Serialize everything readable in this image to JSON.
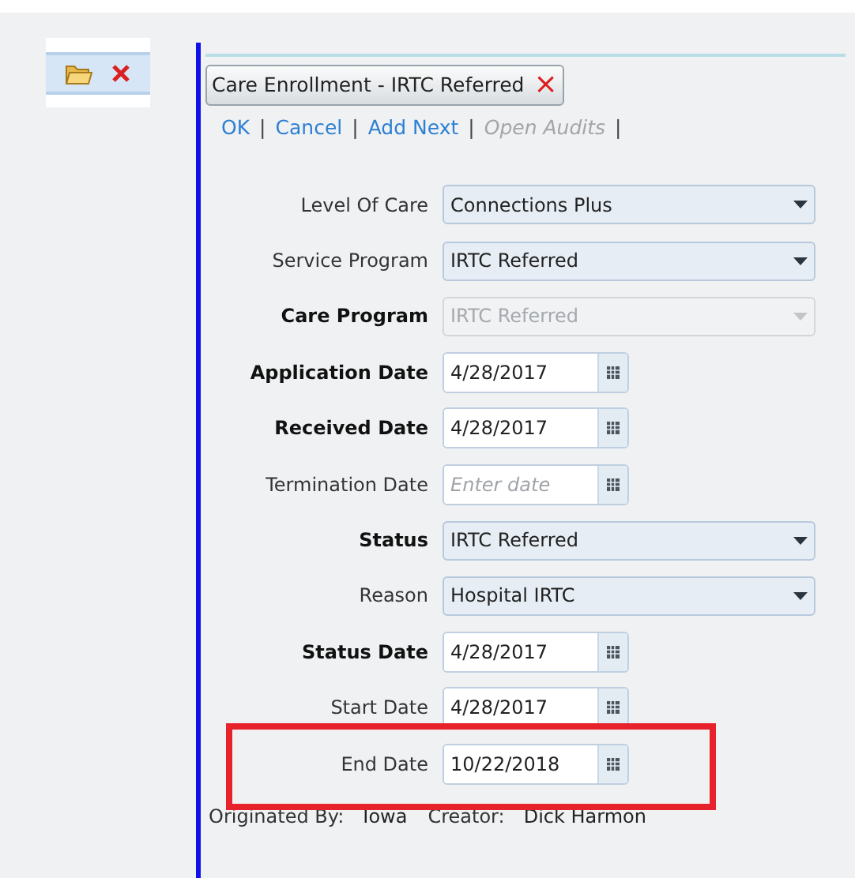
{
  "tab": {
    "title": "Care Enrollment - IRTC Referred",
    "close": "×"
  },
  "actions": [
    {
      "label": "OK",
      "disabled": false
    },
    {
      "label": "Cancel",
      "disabled": false
    },
    {
      "label": "Add Next",
      "disabled": false
    },
    {
      "label": "Open Audits",
      "disabled": true
    }
  ],
  "separator": "|",
  "fields": [
    {
      "kind": "select",
      "label": "Level Of Care",
      "bold": false,
      "value": "Connections Plus",
      "disabled": false,
      "highlighted": false
    },
    {
      "kind": "select",
      "label": "Service Program",
      "bold": false,
      "value": "IRTC Referred",
      "disabled": false,
      "highlighted": false
    },
    {
      "kind": "select",
      "label": "Care Program",
      "bold": true,
      "value": "IRTC Referred",
      "disabled": true,
      "highlighted": false
    },
    {
      "kind": "date",
      "label": "Application Date",
      "bold": true,
      "value": "4/28/2017",
      "disabled": false,
      "highlighted": false
    },
    {
      "kind": "date",
      "label": "Received Date",
      "bold": true,
      "value": "4/28/2017",
      "disabled": false,
      "highlighted": false
    },
    {
      "kind": "date",
      "label": "Termination Date",
      "bold": false,
      "placeholder": "Enter date",
      "disabled": false,
      "highlighted": false
    },
    {
      "kind": "select",
      "label": "Status",
      "bold": true,
      "value": "IRTC Referred",
      "disabled": false,
      "highlighted": false
    },
    {
      "kind": "select",
      "label": "Reason",
      "bold": false,
      "value": "Hospital IRTC",
      "disabled": false,
      "highlighted": false
    },
    {
      "kind": "date",
      "label": "Status Date",
      "bold": true,
      "value": "4/28/2017",
      "disabled": false,
      "highlighted": false
    },
    {
      "kind": "date",
      "label": "Start Date",
      "bold": false,
      "value": "4/28/2017",
      "disabled": false,
      "highlighted": false
    },
    {
      "kind": "date",
      "label": "End Date",
      "bold": false,
      "value": "10/22/2018",
      "disabled": false,
      "highlighted": true
    }
  ],
  "footer": [
    {
      "label": "Originated By:",
      "value": "Iowa"
    },
    {
      "label": "Creator:",
      "value": "Dick Harmon"
    }
  ]
}
